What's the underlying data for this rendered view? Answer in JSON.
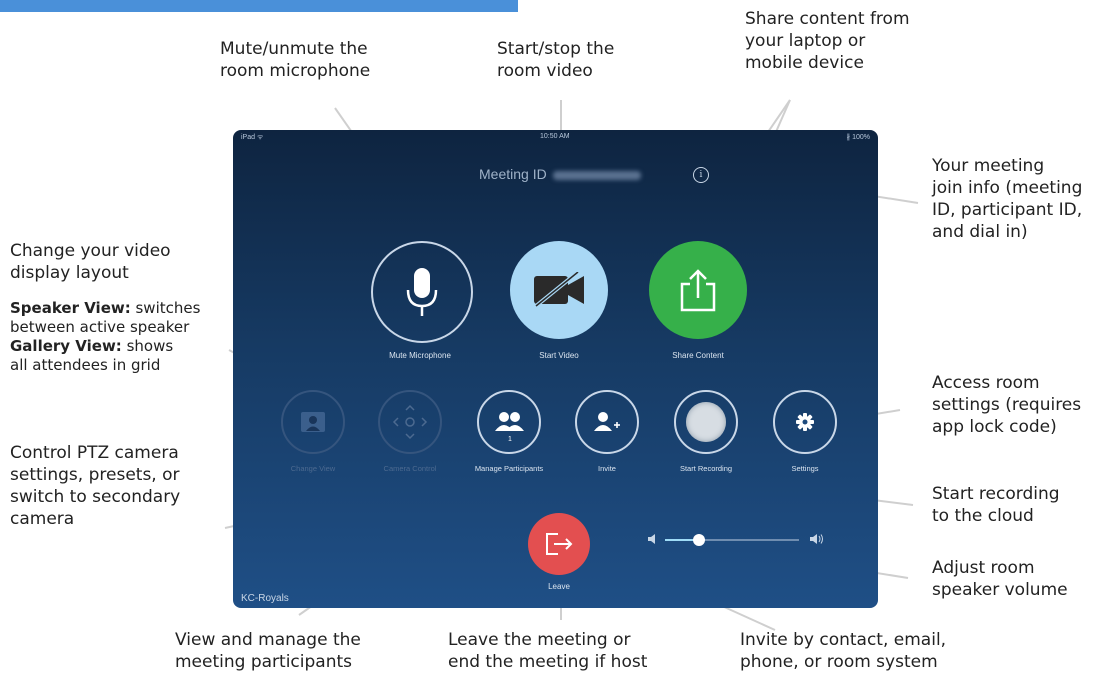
{
  "annotations": {
    "mute": [
      "Mute/unmute the",
      "room microphone"
    ],
    "video": [
      "Start/stop the",
      "room video"
    ],
    "share": [
      "Share content from",
      "your laptop or",
      "mobile device"
    ],
    "join_info": [
      "Your meeting",
      "join info (meeting",
      "ID, participant ID,",
      "and dial in)"
    ],
    "layout_title": [
      "Change your video",
      "display layout"
    ],
    "layout_speaker_bold": "Speaker View:",
    "layout_speaker_rest": " switches",
    "layout_speaker_line2": "between active speaker",
    "layout_gallery_bold": "Gallery View:",
    "layout_gallery_rest": " shows",
    "layout_gallery_line2": "all attendees in grid",
    "settings": [
      "Access room",
      "settings (requires",
      "app lock code)"
    ],
    "ptz": [
      "Control PTZ camera",
      "settings, presets, or",
      "switch to secondary",
      "camera"
    ],
    "recording": [
      "Start recording",
      "to the cloud"
    ],
    "volume": [
      "Adjust room",
      "speaker volume"
    ],
    "participants": [
      "View and manage the",
      "meeting participants"
    ],
    "leave": [
      "Leave the meeting or",
      "end the meeting if host"
    ],
    "invite": [
      "Invite by contact, email,",
      "phone, or room system"
    ]
  },
  "ipad": {
    "status_left": "iPad ᯤ",
    "status_time": "10:50 AM",
    "status_right": "∦ 100%",
    "meeting_id_label": "Meeting ID",
    "buttons": {
      "mute": "Mute Microphone",
      "video": "Start Video",
      "share": "Share Content",
      "change_view": "Change View",
      "camera_control": "Camera Control",
      "manage_participants": "Manage Participants",
      "participant_count": "1",
      "invite": "Invite",
      "start_recording": "Start Recording",
      "settings": "Settings",
      "leave": "Leave"
    },
    "room_name": "KC-Royals",
    "volume_level": 0.25
  },
  "colors": {
    "share_green": "#36b04a",
    "video_blue": "#a9d8f5",
    "leave_red": "#e34f50",
    "header_blue": "#4a90d9"
  },
  "icons": [
    "microphone-icon",
    "video-off-icon",
    "share-icon",
    "info-icon",
    "change-view-icon",
    "camera-control-icon",
    "participants-icon",
    "invite-icon",
    "record-icon",
    "gear-icon",
    "leave-icon",
    "volume-low-icon",
    "volume-high-icon"
  ]
}
